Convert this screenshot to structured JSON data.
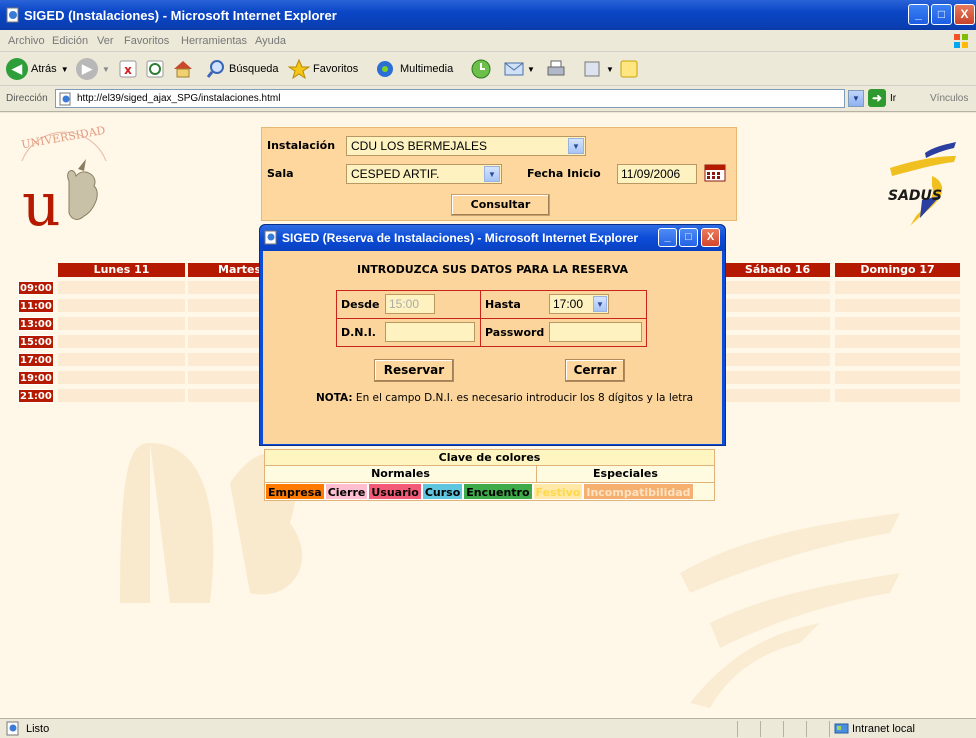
{
  "window": {
    "title": "SIGED (Instalaciones) - Microsoft Internet Explorer",
    "minimize": "_",
    "maximize": "□",
    "close": "X"
  },
  "menu": [
    "Archivo",
    "Edición",
    "Ver",
    "Favoritos",
    "Herramientas",
    "Ayuda"
  ],
  "toolbar": {
    "back": "Atrás",
    "search": "Búsqueda",
    "favorites": "Favoritos",
    "multimedia": "Multimedia"
  },
  "address": {
    "label": "Dirección",
    "url": "http://el39/siged_ajax_SPG/instalaciones.html",
    "go": "Ir",
    "links": "Vínculos"
  },
  "filter": {
    "installation_label": "Instalación",
    "installation_value": "CDU LOS BERMEJALES",
    "room_label": "Sala",
    "room_value": "CESPED ARTIF.",
    "date_label": "Fecha Inicio",
    "date_value": "11/09/2006",
    "submit": "Consultar"
  },
  "schedule": {
    "days": [
      "Lunes 11",
      "Martes",
      "Sábado 16",
      "Domingo 17"
    ],
    "hours": [
      "09:00",
      "11:00",
      "13:00",
      "15:00",
      "17:00",
      "19:00",
      "21:00"
    ]
  },
  "legend": {
    "title": "Clave de colores",
    "normal_label": "Normales",
    "special_label": "Especiales",
    "chips": [
      {
        "label": "Empresa",
        "bg": "#ff7a00",
        "fg": "#000000"
      },
      {
        "label": "Cierre",
        "bg": "#ffbfd0",
        "fg": "#000000"
      },
      {
        "label": "Usuario",
        "bg": "#f25a78",
        "fg": "#000000"
      },
      {
        "label": "Curso",
        "bg": "#5fc6e0",
        "fg": "#000000"
      },
      {
        "label": "Encuentro",
        "bg": "#3faa4a",
        "fg": "#000000"
      },
      {
        "label": "Festivo",
        "bg": "#ffe8a8",
        "fg": "#ffd84a"
      },
      {
        "label": "Incompatibilidad",
        "bg": "#f5b070",
        "fg": "#ffe2c2"
      }
    ]
  },
  "dialog": {
    "title": "SIGED (Reserva de Instalaciones) - Microsoft Internet Explorer",
    "heading": "INTRODUZCA SUS DATOS PARA LA RESERVA",
    "from_label": "Desde",
    "from_value": "15:00",
    "to_label": "Hasta",
    "to_value": "17:00",
    "dni_label": "D.N.I.",
    "dni_value": "",
    "password_label": "Password",
    "password_value": "",
    "reserve": "Reservar",
    "close": "Cerrar",
    "note_label": "NOTA:",
    "note_text": " En el campo D.N.I. es necesario introducir los 8 dígitos y la letra"
  },
  "status": {
    "text": "Listo",
    "zone": "Intranet local"
  },
  "colors": {
    "accent_red": "#b51a00",
    "panel": "#fdd79e",
    "xp_blue": "#0b4cd8"
  }
}
